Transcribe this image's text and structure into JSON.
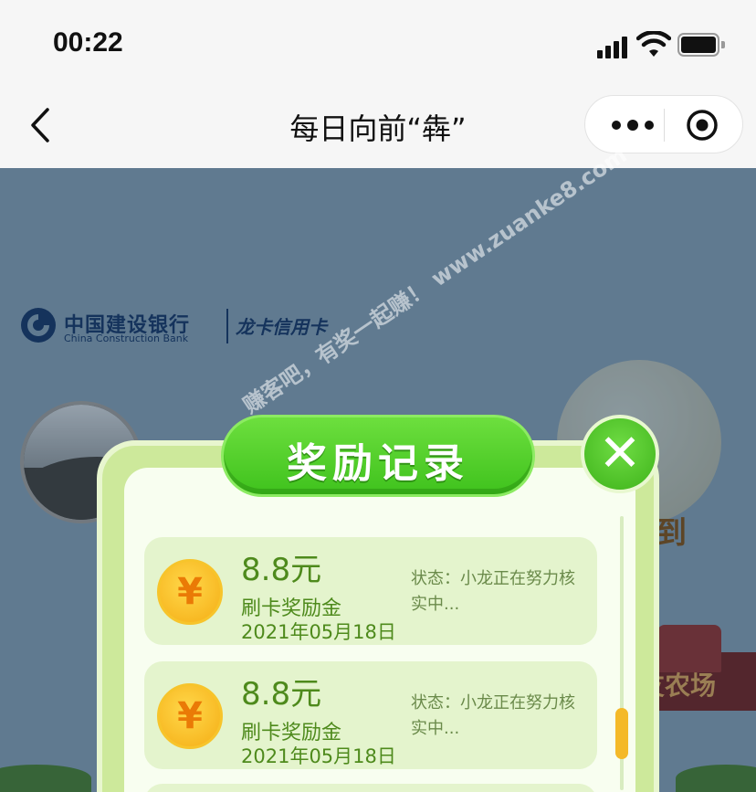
{
  "status_bar": {
    "time": "00:22"
  },
  "nav": {
    "title": "每日向前“犇”"
  },
  "bank": {
    "name_cn": "中国建设银行",
    "name_en": "China Construction Bank",
    "card_name": "龙卡信用卡"
  },
  "background": {
    "right_text": "到",
    "farm_label": "友农场"
  },
  "watermark": "赚客吧，有奖一起赚！ www.zuanke8.com",
  "modal": {
    "title": "奖励记录",
    "close_label": "✕",
    "records": [
      {
        "currency_symbol": "¥",
        "amount": "8.8元",
        "type": "刷卡奖励金",
        "date": "2021年05月18日",
        "status": "状态：小龙正在努力核实中..."
      },
      {
        "currency_symbol": "¥",
        "amount": "8.8元",
        "type": "刷卡奖励金",
        "date": "2021年05月18日",
        "status": "状态：小龙正在努力核实中..."
      }
    ]
  }
}
